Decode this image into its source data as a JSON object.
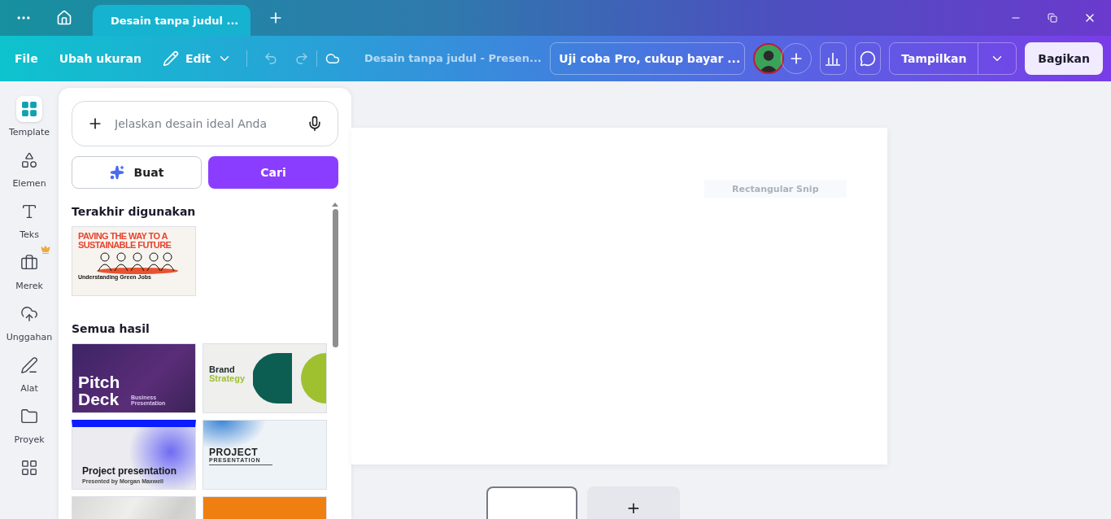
{
  "tabs": [
    {
      "title": "Desain tanpa judul ...",
      "selected": true
    }
  ],
  "toolbar": {
    "menu": [
      "File",
      "Ubah ukuran"
    ],
    "edit": "Edit",
    "design_title": "Desain tanpa judul - Presen...",
    "pro_trial": "Uji coba Pro, cukup bayar ...",
    "view_button": "Tampilkan",
    "share_button": "Bagikan"
  },
  "rail": [
    {
      "label": "Template",
      "selected": true,
      "pro": false
    },
    {
      "label": "Elemen",
      "selected": false,
      "pro": false
    },
    {
      "label": "Teks",
      "selected": false,
      "pro": false
    },
    {
      "label": "Merek",
      "selected": false,
      "pro": true
    },
    {
      "label": "Unggahan",
      "selected": false,
      "pro": false
    },
    {
      "label": "Alat",
      "selected": false,
      "pro": false
    },
    {
      "label": "Proyek",
      "selected": false,
      "pro": false
    },
    {
      "selected": false,
      "pro": false
    }
  ],
  "panel": {
    "prompt_placeholder": "Jelaskan desain ideal Anda",
    "create_button": "Buat",
    "search_button": "Cari",
    "recent_heading": "Terakhir digunakan",
    "recent": [
      {
        "kind": "paving",
        "texts": [
          "PAVING THE WAY TO A SUSTAINABLE FUTURE",
          "Understanding Green Jobs"
        ]
      }
    ],
    "results_heading": "Semua hasil",
    "results": [
      {
        "kind": "pitch",
        "texts": [
          "Pitch Deck",
          "Business Presentation"
        ]
      },
      {
        "kind": "brand",
        "texts": [
          "Brand",
          "Strategy"
        ]
      },
      {
        "kind": "blob",
        "texts": [
          "Project presentation",
          "Presented by Morgan Maxwell"
        ]
      },
      {
        "kind": "wave",
        "texts": [
          "PROJECT",
          "PRESENTATION"
        ]
      },
      {
        "kind": "paper"
      },
      {
        "kind": "annual"
      }
    ]
  },
  "canvas": {
    "ghost_label": "Rectangular Snip"
  },
  "pages": [
    {
      "kind": "page",
      "selected": true
    },
    {
      "kind": "add",
      "label": "+"
    }
  ]
}
